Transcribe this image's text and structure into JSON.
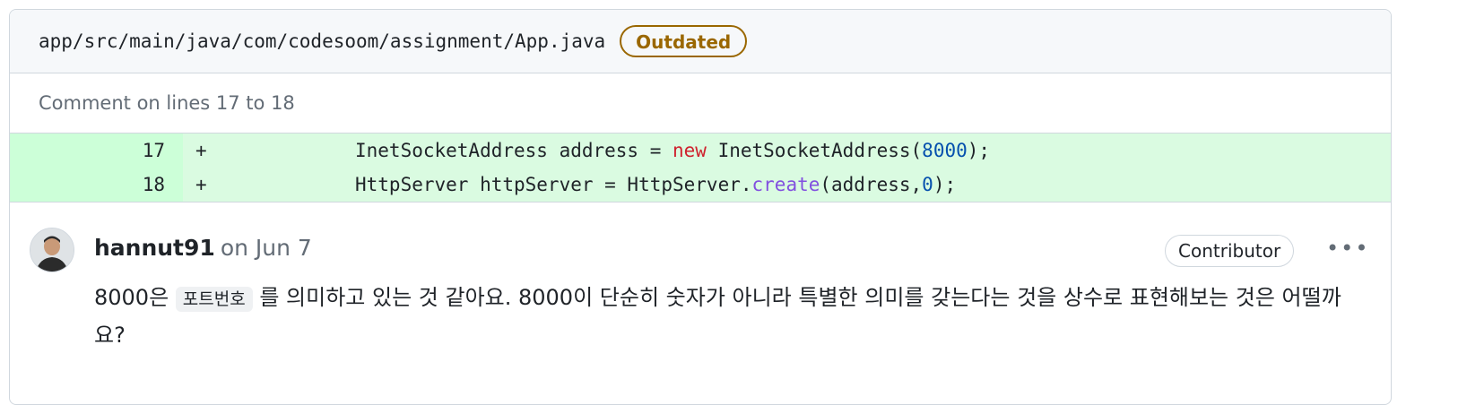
{
  "file": {
    "path": "app/src/main/java/com/codesoom/assignment/App.java",
    "badge": "Outdated"
  },
  "comment_range": "Comment on lines 17 to 18",
  "diff": [
    {
      "line": "17",
      "sign": "+",
      "tokens": [
        {
          "text": "InetSocketAddress address = ",
          "cls": ""
        },
        {
          "text": "new",
          "cls": "kw"
        },
        {
          "text": " InetSocketAddress(",
          "cls": ""
        },
        {
          "text": "8000",
          "cls": "num"
        },
        {
          "text": ");",
          "cls": ""
        }
      ]
    },
    {
      "line": "18",
      "sign": "+",
      "tokens": [
        {
          "text": "HttpServer httpServer = HttpServer.",
          "cls": ""
        },
        {
          "text": "create",
          "cls": "fn"
        },
        {
          "text": "(address,",
          "cls": ""
        },
        {
          "text": "0",
          "cls": "num"
        },
        {
          "text": ");",
          "cls": ""
        }
      ]
    }
  ],
  "review": {
    "author": "hannut91",
    "date": "on Jun 7",
    "role_badge": "Contributor",
    "more_label": "•••",
    "text_before": "8000은 ",
    "inline_code": "포트번호",
    "text_after": " 를 의미하고 있는 것 같아요. 8000이 단순히 숫자가 아니라 특별한 의미를 갖는다는 것을 상수로 표현해보는 것은 어떨까요?"
  }
}
